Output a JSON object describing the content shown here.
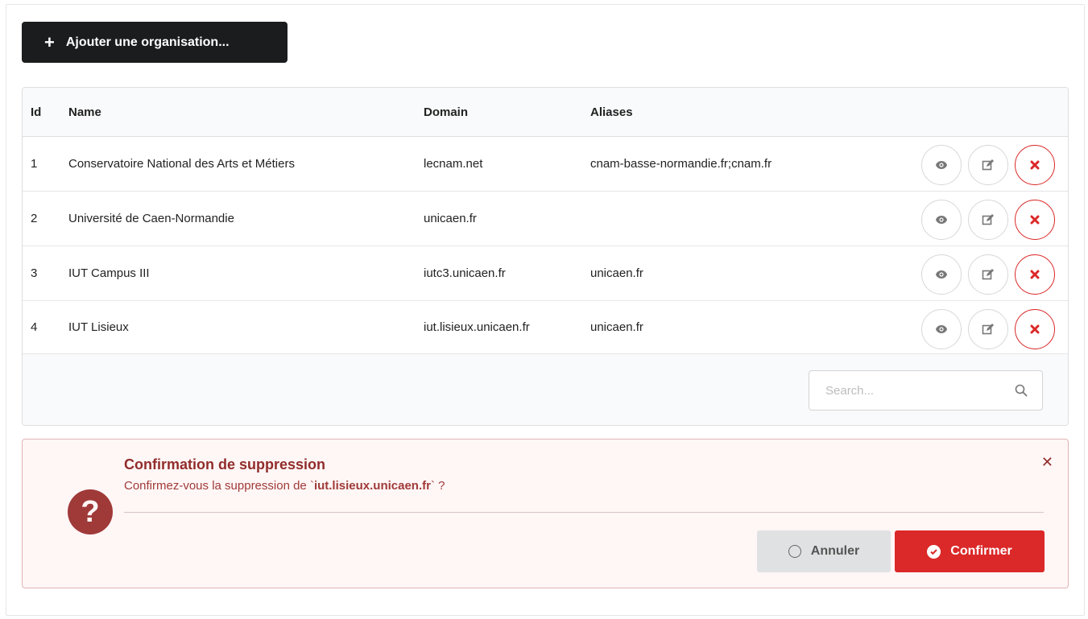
{
  "toolbar": {
    "add_label": "Ajouter une organisation..."
  },
  "table": {
    "headers": {
      "id": "Id",
      "name": "Name",
      "domain": "Domain",
      "aliases": "Aliases"
    },
    "rows": [
      {
        "id": "1",
        "name": "Conservatoire National des Arts et Métiers",
        "domain": "lecnam.net",
        "aliases": "cnam-basse-normandie.fr;cnam.fr"
      },
      {
        "id": "2",
        "name": "Université de Caen-Normandie",
        "domain": "unicaen.fr",
        "aliases": ""
      },
      {
        "id": "3",
        "name": "IUT Campus III",
        "domain": "iutc3.unicaen.fr",
        "aliases": "unicaen.fr"
      },
      {
        "id": "4",
        "name": "IUT Lisieux",
        "domain": "iut.lisieux.unicaen.fr",
        "aliases": "unicaen.fr"
      }
    ]
  },
  "search": {
    "placeholder": "Search..."
  },
  "confirm": {
    "title": "Confirmation de suppression",
    "message_prefix": "Confirmez-vous la suppression de `",
    "target": "iut.lisieux.unicaen.fr",
    "message_suffix": "` ?",
    "cancel_label": "Annuler",
    "confirm_label": "Confirmer"
  },
  "colors": {
    "danger": "#db2828",
    "dark_button": "#1b1c1d",
    "alert_bg": "#fff6f6",
    "alert_text": "#9f3a38"
  },
  "icons": {
    "add": "plus-icon",
    "view": "eye-icon",
    "edit": "edit-icon",
    "delete": "close-icon",
    "search": "search-icon",
    "question": "question-circle-icon",
    "cancel": "circle-outline-icon",
    "confirm": "check-circle-icon"
  }
}
